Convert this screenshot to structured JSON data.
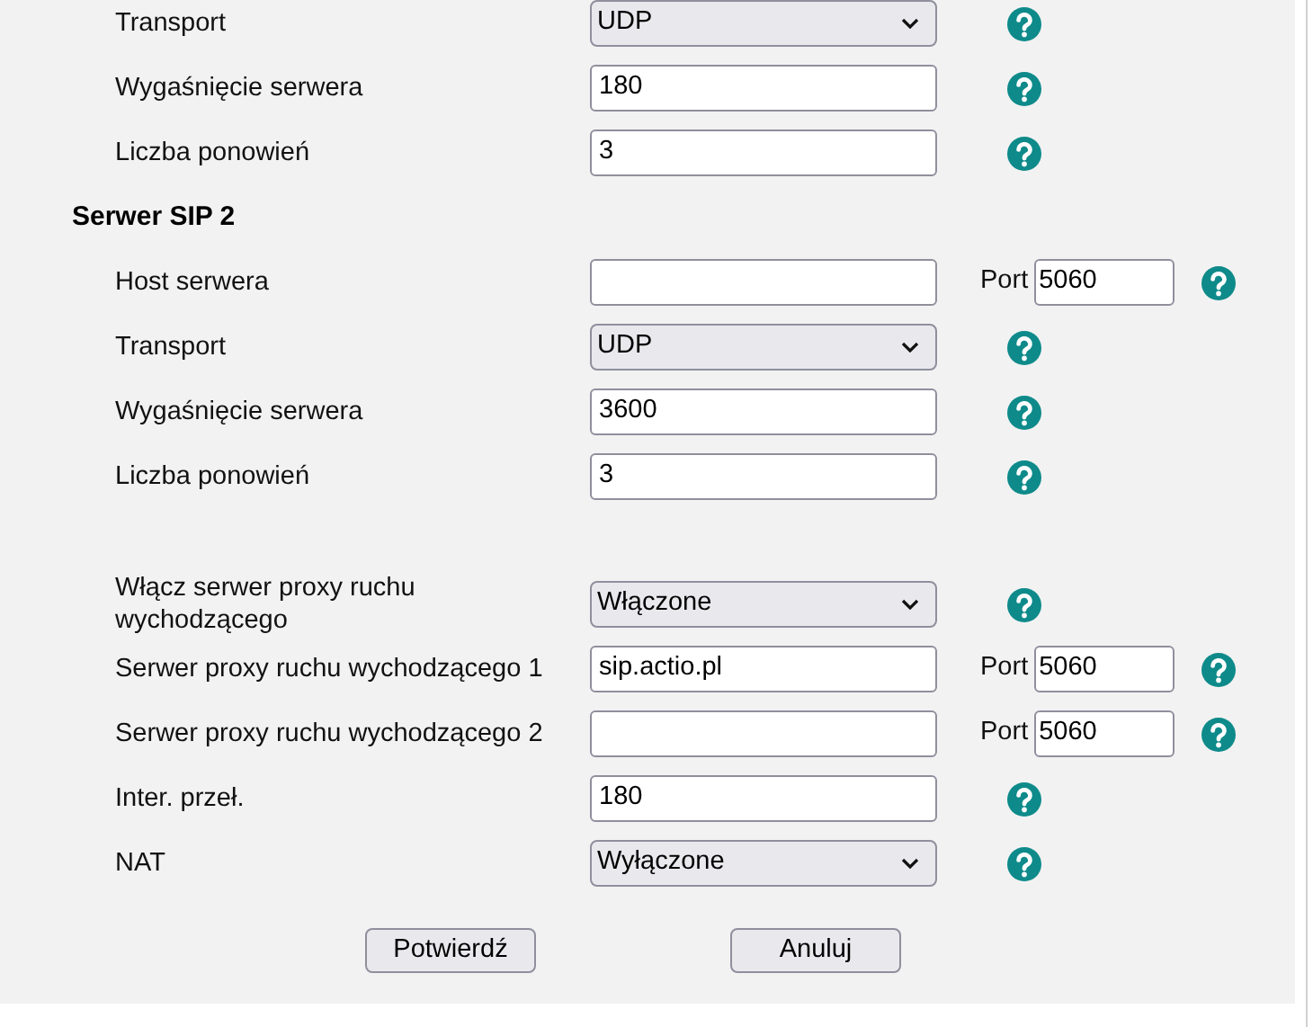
{
  "sections": [
    {
      "rows": [
        {
          "label": "Transport",
          "kind": "select",
          "value": "UDP"
        },
        {
          "label": "Wygaśnięcie serwera",
          "kind": "input",
          "value": "180"
        },
        {
          "label": "Liczba ponowień",
          "kind": "input",
          "value": "3"
        }
      ]
    },
    {
      "heading": "Serwer SIP 2",
      "rows": [
        {
          "label": "Host serwera",
          "kind": "input",
          "port_label": "Port",
          "port": "5060"
        },
        {
          "label": "Transport",
          "kind": "select",
          "value": "UDP"
        },
        {
          "label": "Wygaśnięcie serwera",
          "kind": "input",
          "value": "3600"
        },
        {
          "label": "Liczba ponowień",
          "kind": "input",
          "value": "3"
        }
      ]
    },
    {
      "rows": [
        {
          "label": "Włącz serwer proxy ruchu wychodzącego",
          "kind": "select",
          "value": "Włączone"
        },
        {
          "label": "Serwer proxy ruchu wychodzącego 1",
          "kind": "input",
          "value": "sip.actio.pl",
          "port_label": "Port",
          "port": "5060"
        },
        {
          "label": "Serwer proxy ruchu wychodzącego 2",
          "kind": "input",
          "port_label": "Port",
          "port": "5060"
        },
        {
          "label": "Inter. przeł.",
          "kind": "input",
          "value": "180"
        },
        {
          "label": "NAT",
          "kind": "select",
          "value": "Wyłączone"
        }
      ]
    }
  ],
  "buttons": [
    "Potwierdź",
    "Anuluj"
  ]
}
